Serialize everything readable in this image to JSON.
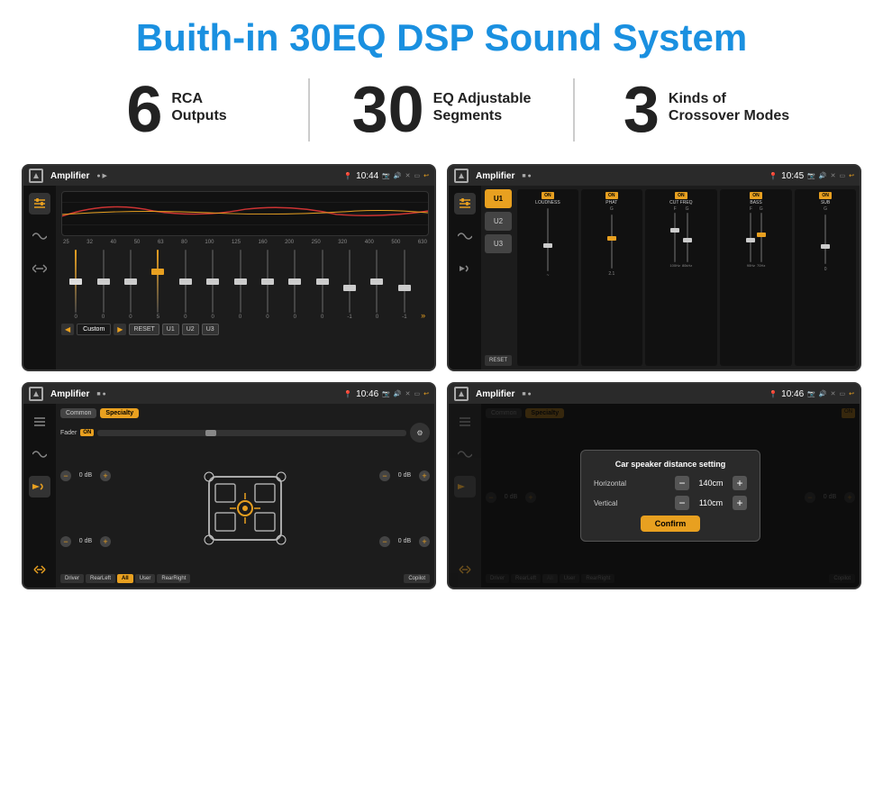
{
  "header": {
    "title": "Buith-in 30EQ DSP Sound System"
  },
  "stats": [
    {
      "number": "6",
      "label_top": "RCA",
      "label_bottom": "Outputs"
    },
    {
      "number": "30",
      "label_top": "EQ Adjustable",
      "label_bottom": "Segments"
    },
    {
      "number": "3",
      "label_top": "Kinds of",
      "label_bottom": "Crossover Modes"
    }
  ],
  "screens": {
    "eq": {
      "app_name": "Amplifier",
      "time": "10:44",
      "freq_labels": [
        "25",
        "32",
        "40",
        "50",
        "63",
        "80",
        "100",
        "125",
        "160",
        "200",
        "250",
        "320",
        "400",
        "500",
        "630"
      ],
      "preset_name": "Custom",
      "buttons": [
        "◀",
        "Custom",
        "▶",
        "RESET",
        "U1",
        "U2",
        "U3"
      ],
      "slider_values": [
        "0",
        "0",
        "0",
        "5",
        "0",
        "0",
        "0",
        "0",
        "0",
        "0",
        "-1",
        "0",
        "-1"
      ]
    },
    "crossover": {
      "app_name": "Amplifier",
      "time": "10:45",
      "presets": [
        "U1",
        "U2",
        "U3"
      ],
      "sections": [
        {
          "label": "LOUDNESS",
          "on": true
        },
        {
          "label": "PHAT",
          "on": true
        },
        {
          "label": "CUT FREQ",
          "on": true
        },
        {
          "label": "BASS",
          "on": true
        },
        {
          "label": "SUB",
          "on": true
        }
      ],
      "reset_label": "RESET"
    },
    "fader": {
      "app_name": "Amplifier",
      "time": "10:46",
      "tabs": [
        "Common",
        "Specialty"
      ],
      "fader_label": "Fader",
      "on_label": "ON",
      "positions": [
        "Driver",
        "RearLeft",
        "All",
        "User",
        "RearRight",
        "Copilot"
      ],
      "volumes": [
        "0 dB",
        "0 dB",
        "0 dB",
        "0 dB"
      ]
    },
    "dialog": {
      "app_name": "Amplifier",
      "time": "10:46",
      "tabs": [
        "Common",
        "Specialty"
      ],
      "dialog_title": "Car speaker distance setting",
      "horizontal_label": "Horizontal",
      "horizontal_value": "140cm",
      "vertical_label": "Vertical",
      "vertical_value": "110cm",
      "confirm_label": "Confirm",
      "positions": [
        "Driver",
        "RearLeft",
        "All",
        "User",
        "RearRight",
        "Copilot"
      ],
      "volumes": [
        "0 dB",
        "0 dB"
      ]
    }
  },
  "colors": {
    "accent": "#1a90e0",
    "orange": "#e8a020",
    "bg_dark": "#1a1a1a",
    "text_primary": "#222222"
  }
}
